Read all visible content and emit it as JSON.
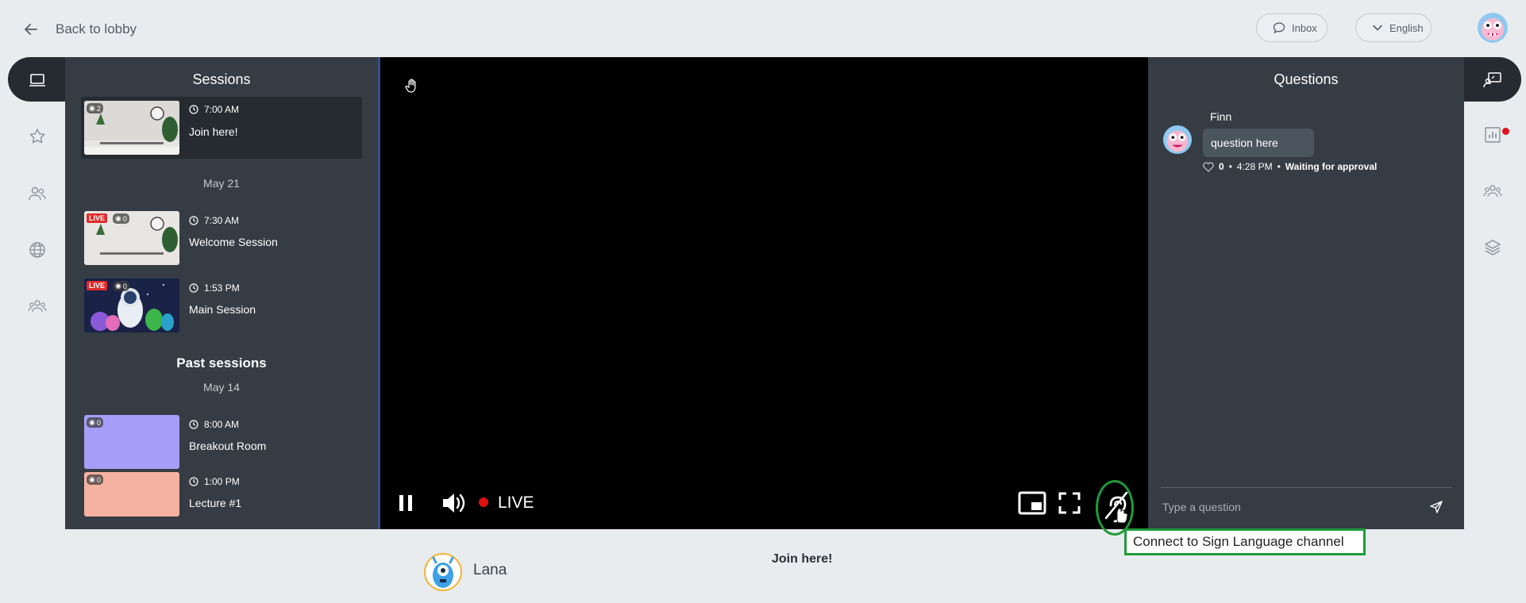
{
  "topbar": {
    "back_label": "Back to lobby",
    "inbox_label": "Inbox",
    "language_label": "English"
  },
  "sessions": {
    "title": "Sessions",
    "current": {
      "time": "7:00 AM",
      "title": "Join here!",
      "viewers": "2"
    },
    "groups": [
      {
        "date": "May 21",
        "items": [
          {
            "time": "7:30 AM",
            "title": "Welcome Session",
            "live": "LIVE",
            "viewers": "0"
          },
          {
            "time": "1:53 PM",
            "title": "Main Session",
            "live": "LIVE",
            "viewers": "0"
          }
        ]
      }
    ],
    "past_heading": "Past sessions",
    "past_groups": [
      {
        "date": "May 14",
        "items": [
          {
            "time": "8:00 AM",
            "title": "Breakout Room",
            "viewers": "0",
            "color": "#a59ef8"
          },
          {
            "time": "1:00 PM",
            "title": "Lecture #1",
            "viewers": "0",
            "color": "#f6b2a0"
          }
        ]
      }
    ]
  },
  "video": {
    "live_label": "LIVE",
    "tooltip": "Connect to Sign Language channel"
  },
  "questions": {
    "title": "Questions",
    "items": [
      {
        "author": "Finn",
        "text": "question here",
        "likes": "0",
        "time": "4:28 PM",
        "status": "Waiting for approval"
      }
    ],
    "input_placeholder": "Type a question"
  },
  "footer": {
    "presenter_name": "Lana",
    "session_title": "Join here!"
  },
  "colors": {
    "panel_bg": "#353c44",
    "dark_bar": "#262b31",
    "live_red": "#e02b2b",
    "highlight_green": "#1f9a3a",
    "notification_dot": "#e0141e"
  }
}
